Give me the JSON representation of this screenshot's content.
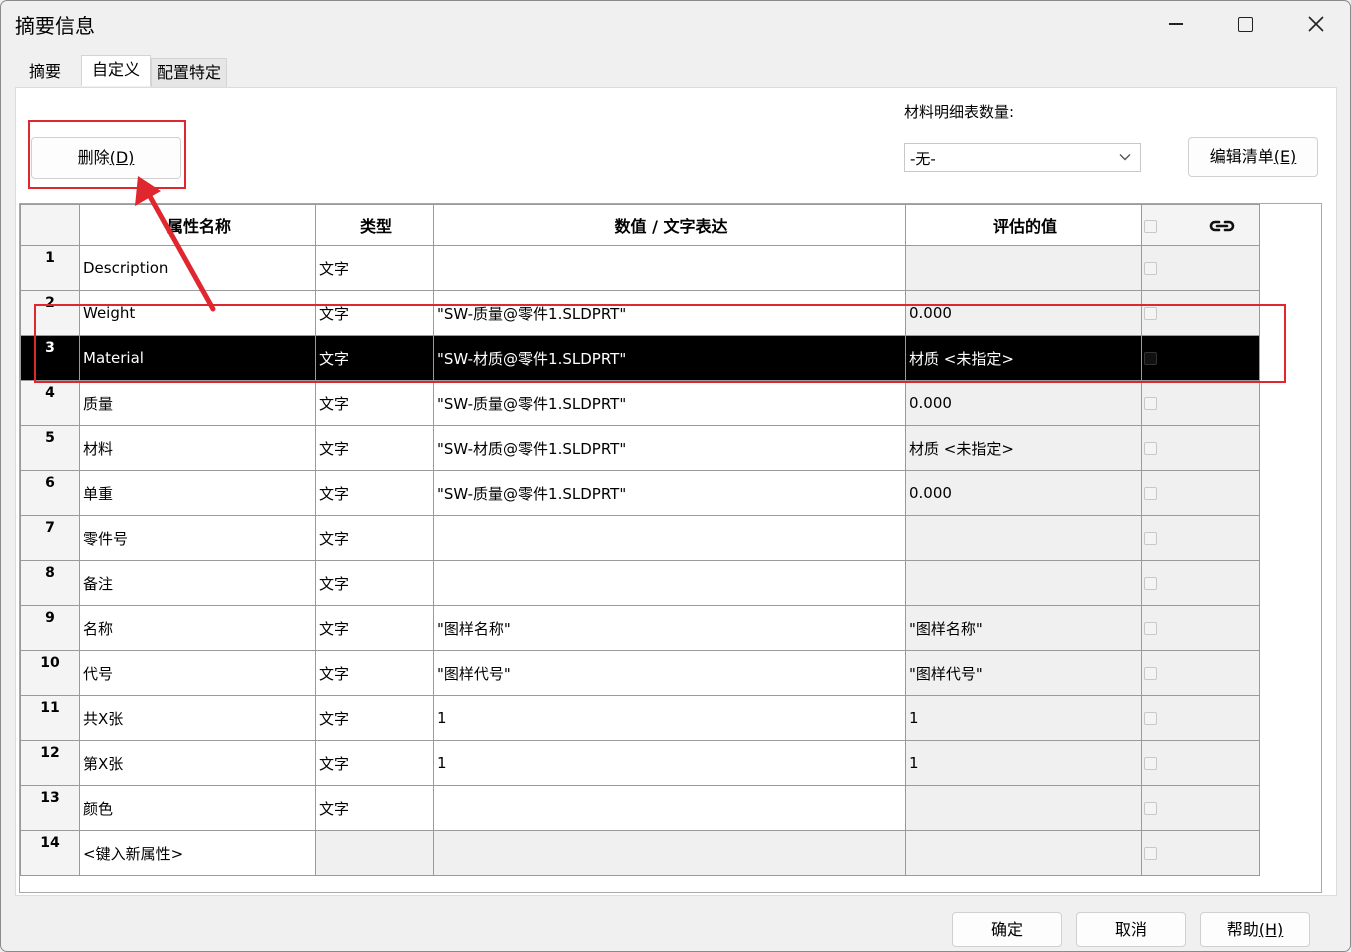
{
  "window": {
    "title": "摘要信息"
  },
  "tabs": [
    {
      "label": "摘要"
    },
    {
      "label": "自定义"
    },
    {
      "label": "配置特定"
    }
  ],
  "toolbar": {
    "delete_label": "删除",
    "delete_hotkey": "(D)",
    "bom_qty_label": "材料明细表数量:",
    "bom_qty_value": "-无-",
    "edit_list_label": "编辑清单",
    "edit_list_hotkey": "(E)"
  },
  "table": {
    "headers": {
      "property_name": "属性名称",
      "type": "类型",
      "value": "数值 / 文字表达",
      "evaluated": "评估的值"
    },
    "rows": [
      {
        "num": "1",
        "name": "Description",
        "type": "文字",
        "value": "",
        "evaluated": ""
      },
      {
        "num": "2",
        "name": "Weight",
        "type": "文字",
        "value": "\"SW-质量@零件1.SLDPRT\"",
        "evaluated": "0.000"
      },
      {
        "num": "3",
        "name": "Material",
        "type": "文字",
        "value": "\"SW-材质@零件1.SLDPRT\"",
        "evaluated": "材质 <未指定>"
      },
      {
        "num": "4",
        "name": "质量",
        "type": "文字",
        "value": "\"SW-质量@零件1.SLDPRT\"",
        "evaluated": "0.000"
      },
      {
        "num": "5",
        "name": "材料",
        "type": "文字",
        "value": "\"SW-材质@零件1.SLDPRT\"",
        "evaluated": "材质 <未指定>"
      },
      {
        "num": "6",
        "name": "单重",
        "type": "文字",
        "value": "\"SW-质量@零件1.SLDPRT\"",
        "evaluated": "0.000"
      },
      {
        "num": "7",
        "name": "零件号",
        "type": "文字",
        "value": "",
        "evaluated": ""
      },
      {
        "num": "8",
        "name": "备注",
        "type": "文字",
        "value": "",
        "evaluated": ""
      },
      {
        "num": "9",
        "name": "名称",
        "type": "文字",
        "value": "\"图样名称\"",
        "evaluated": "\"图样名称\""
      },
      {
        "num": "10",
        "name": "代号",
        "type": "文字",
        "value": "\"图样代号\"",
        "evaluated": "\"图样代号\""
      },
      {
        "num": "11",
        "name": "共X张",
        "type": "文字",
        "value": "1",
        "evaluated": "1"
      },
      {
        "num": "12",
        "name": "第X张",
        "type": "文字",
        "value": "1",
        "evaluated": "1"
      },
      {
        "num": "13",
        "name": "颜色",
        "type": "文字",
        "value": "",
        "evaluated": ""
      },
      {
        "num": "14",
        "name": "<键入新属性>",
        "type": "",
        "value": "",
        "evaluated": ""
      }
    ],
    "selected_row": "3"
  },
  "footer": {
    "ok_label": "确定",
    "cancel_label": "取消",
    "help_label": "帮助",
    "help_hotkey": "(H)"
  },
  "colors": {
    "annotation": "#e0262f",
    "selected_row_bg": "#000000"
  }
}
